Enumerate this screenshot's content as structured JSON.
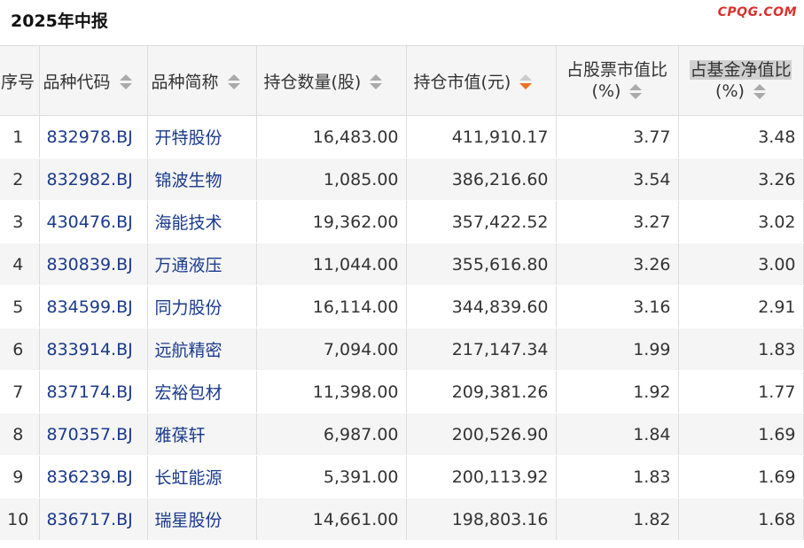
{
  "header": {
    "title": "2025年中报",
    "watermark": "CPQG.COM"
  },
  "table": {
    "columns": {
      "index": "序号",
      "code": "品种代码",
      "name": "品种简称",
      "shares": "持仓数量(股)",
      "value": "持仓市值(元)",
      "stock_ratio_line1": "占股票市值比",
      "stock_ratio_line2": "(%)",
      "nav_ratio_line1": "占基金净值比",
      "nav_ratio_line2": "(%)"
    },
    "sorted_column": "持仓市值(元)",
    "sort_direction": "descending",
    "rows": [
      {
        "index": "1",
        "code": "832978.BJ",
        "name": "开特股份",
        "shares": "16,483.00",
        "value": "411,910.17",
        "stock_ratio": "3.77",
        "nav_ratio": "3.48"
      },
      {
        "index": "2",
        "code": "832982.BJ",
        "name": "锦波生物",
        "shares": "1,085.00",
        "value": "386,216.60",
        "stock_ratio": "3.54",
        "nav_ratio": "3.26"
      },
      {
        "index": "3",
        "code": "430476.BJ",
        "name": "海能技术",
        "shares": "19,362.00",
        "value": "357,422.52",
        "stock_ratio": "3.27",
        "nav_ratio": "3.02"
      },
      {
        "index": "4",
        "code": "830839.BJ",
        "name": "万通液压",
        "shares": "11,044.00",
        "value": "355,616.80",
        "stock_ratio": "3.26",
        "nav_ratio": "3.00"
      },
      {
        "index": "5",
        "code": "834599.BJ",
        "name": "同力股份",
        "shares": "16,114.00",
        "value": "344,839.60",
        "stock_ratio": "3.16",
        "nav_ratio": "2.91"
      },
      {
        "index": "6",
        "code": "833914.BJ",
        "name": "远航精密",
        "shares": "7,094.00",
        "value": "217,147.34",
        "stock_ratio": "1.99",
        "nav_ratio": "1.83"
      },
      {
        "index": "7",
        "code": "837174.BJ",
        "name": "宏裕包材",
        "shares": "11,398.00",
        "value": "209,381.26",
        "stock_ratio": "1.92",
        "nav_ratio": "1.77"
      },
      {
        "index": "8",
        "code": "870357.BJ",
        "name": "雅葆轩",
        "shares": "6,987.00",
        "value": "200,526.90",
        "stock_ratio": "1.84",
        "nav_ratio": "1.69"
      },
      {
        "index": "9",
        "code": "836239.BJ",
        "name": "长虹能源",
        "shares": "5,391.00",
        "value": "200,113.92",
        "stock_ratio": "1.83",
        "nav_ratio": "1.69"
      },
      {
        "index": "10",
        "code": "836717.BJ",
        "name": "瑞星股份",
        "shares": "14,661.00",
        "value": "198,803.16",
        "stock_ratio": "1.82",
        "nav_ratio": "1.68"
      }
    ]
  },
  "colors": {
    "link": "#1a3a8c",
    "sort_active": "#f07020",
    "watermark": "#d9302c",
    "row_alt": "#f5f5f5",
    "header_bg": "#f5f5f5",
    "highlight": "#d0d0d0"
  }
}
